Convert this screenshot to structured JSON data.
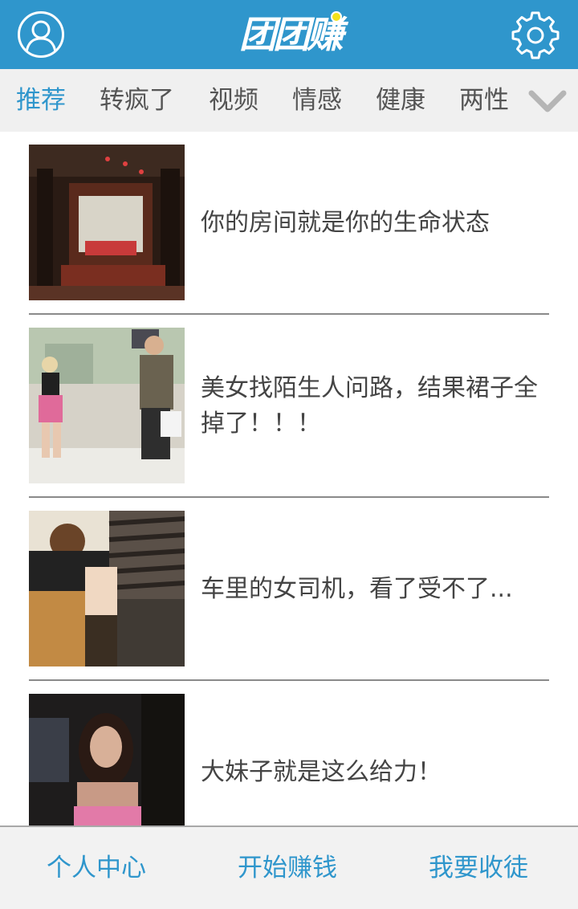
{
  "header": {
    "logo_text": "团团赚",
    "avatar_icon": "user-avatar-icon",
    "settings_icon": "gear-icon",
    "brand_color": "#2f96cc"
  },
  "tabs": {
    "items": [
      {
        "label": "推荐",
        "active": true
      },
      {
        "label": "转疯了",
        "active": false
      },
      {
        "label": "视频",
        "active": false
      },
      {
        "label": "情感",
        "active": false
      },
      {
        "label": "健康",
        "active": false
      },
      {
        "label": "两性",
        "active": false
      }
    ],
    "more_icon": "chevron-down-icon"
  },
  "articles": [
    {
      "title": "你的房间就是你的生命状态"
    },
    {
      "title": "美女找陌生人问路，结果裙子全掉了！！！"
    },
    {
      "title": "车里的女司机，看了受不了..."
    },
    {
      "title": "大妹子就是这么给力！"
    }
  ],
  "bottom_bar": {
    "profile_label": "个人中心",
    "earn_label": "开始赚钱",
    "recruit_label": "我要收徒"
  }
}
